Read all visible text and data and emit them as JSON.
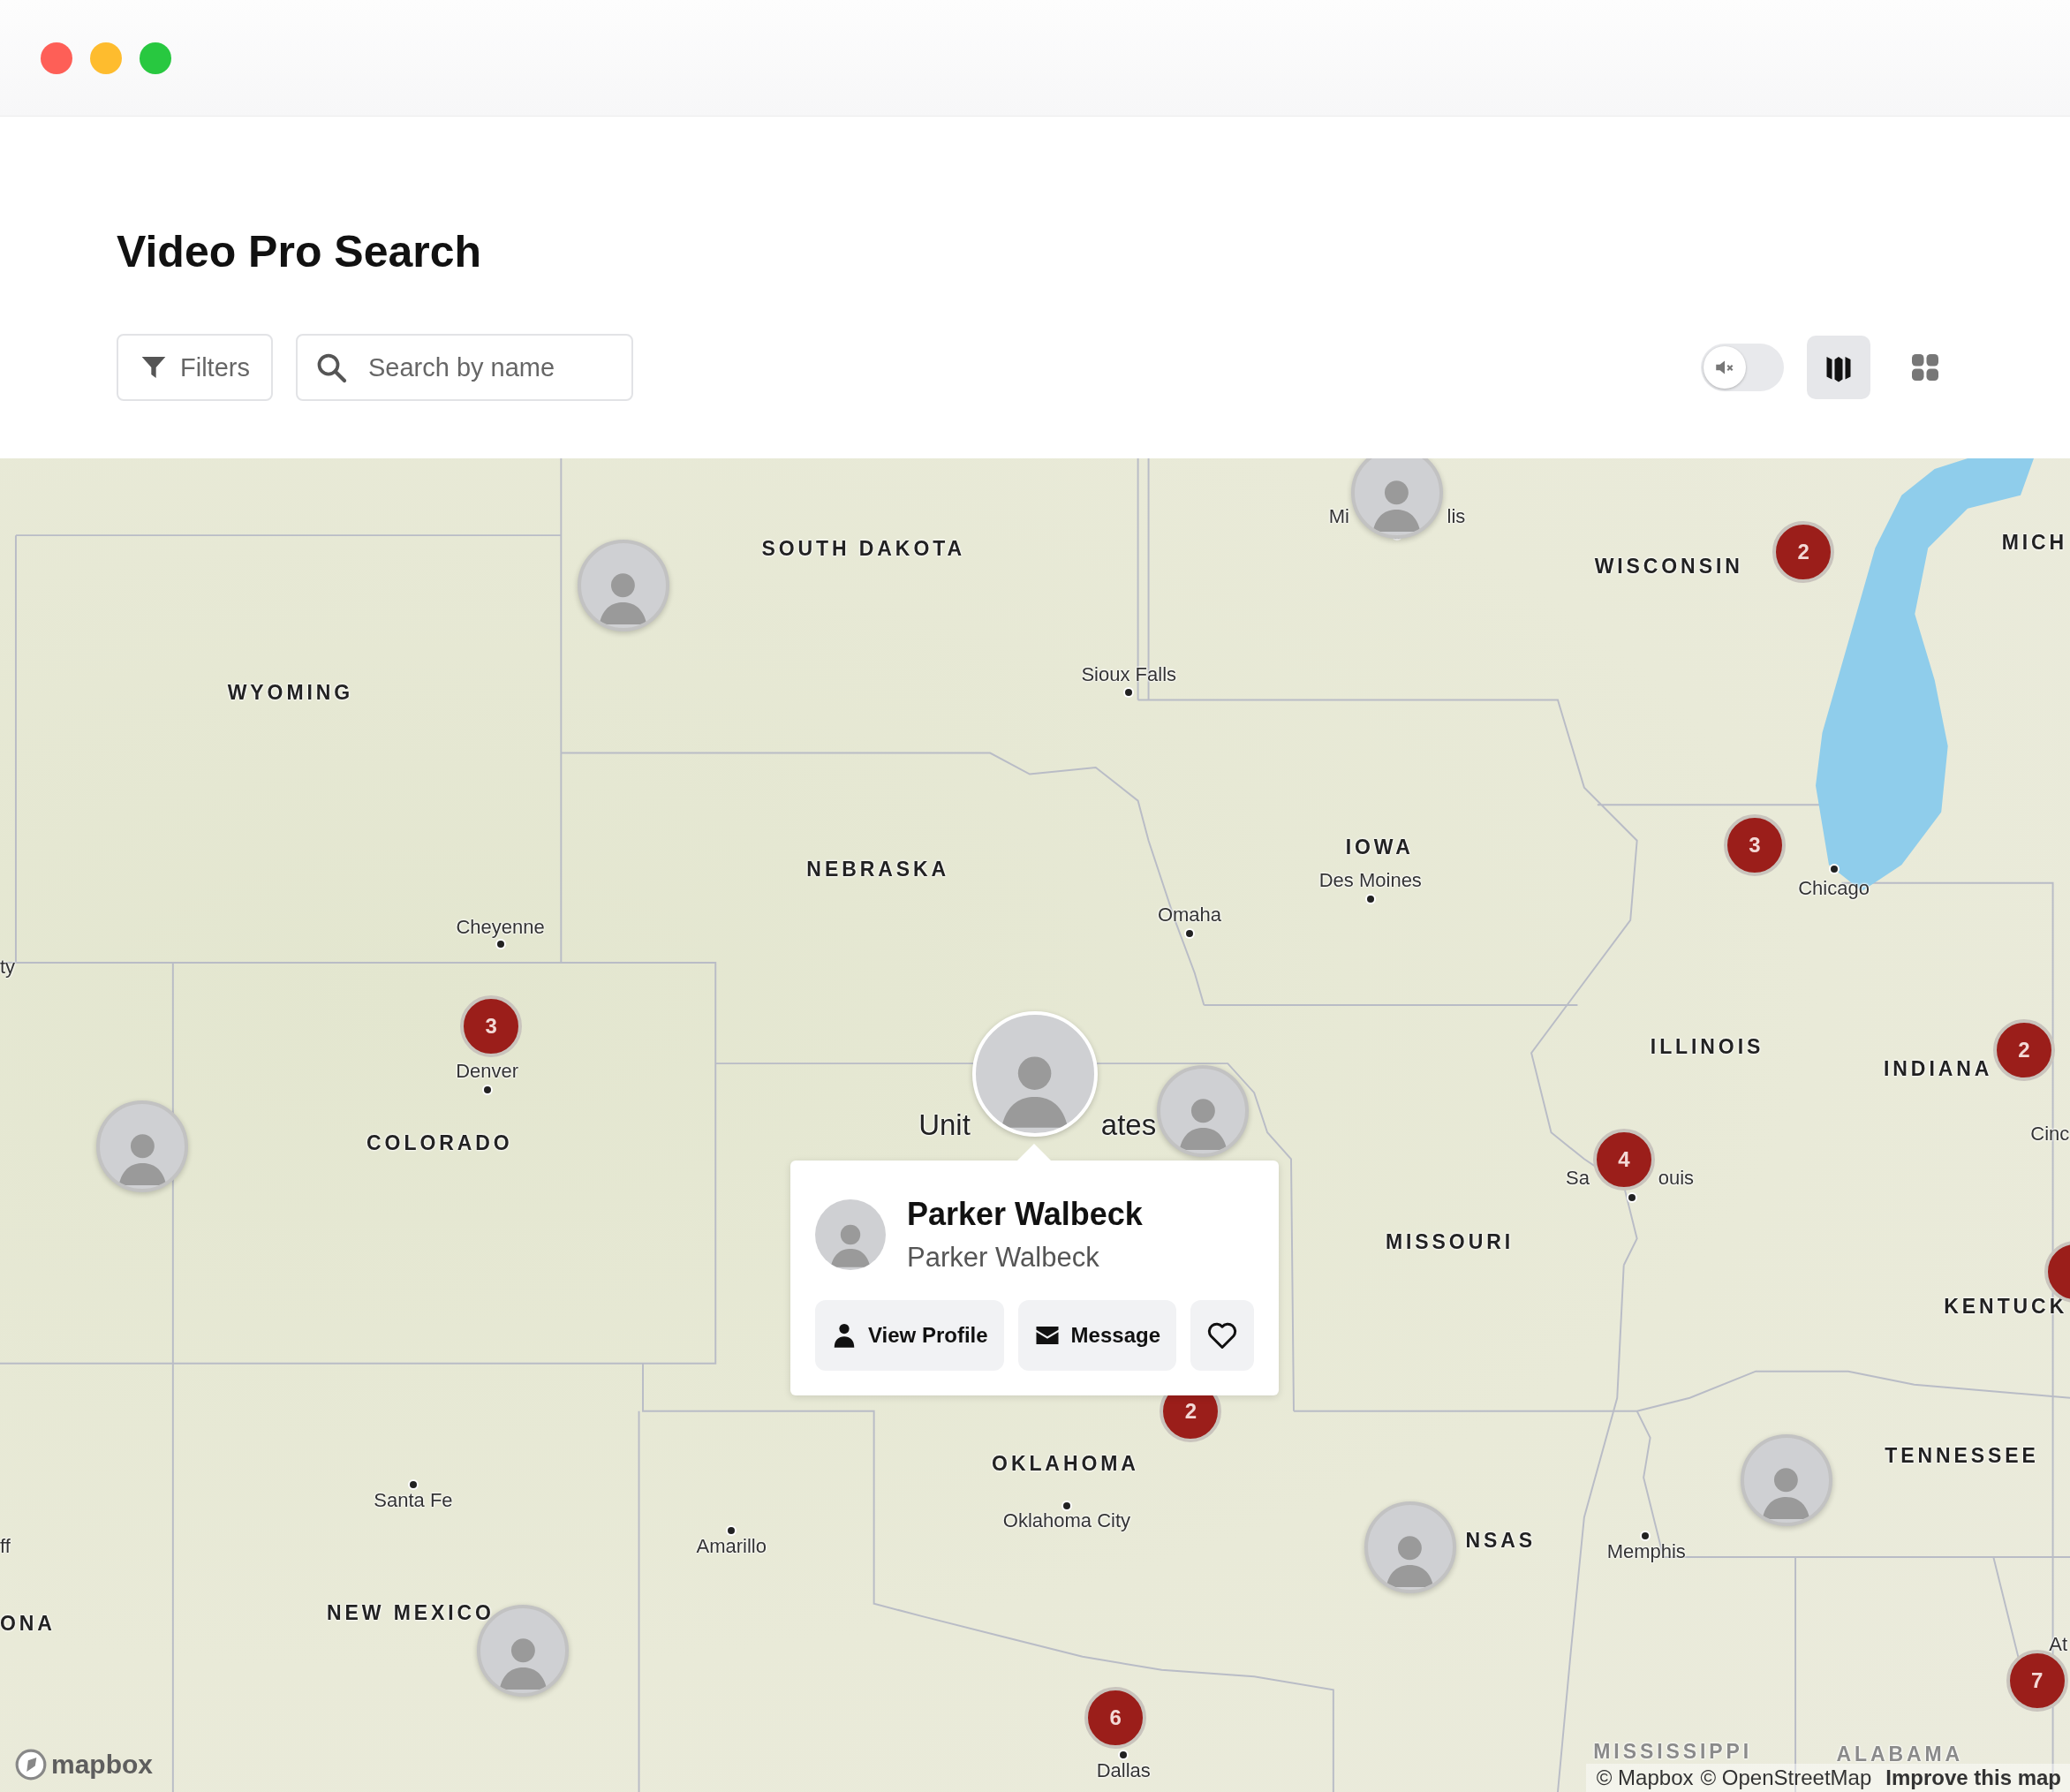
{
  "title": "Video Pro Search",
  "toolbar": {
    "filters_button": "Filters",
    "search": {
      "placeholder": "Search by name"
    },
    "sound_toggle": {
      "on": false
    },
    "view_buttons": [
      {
        "kind": "map",
        "selected": true
      },
      {
        "kind": "grid",
        "selected": false
      }
    ]
  },
  "map": {
    "labels": [
      {
        "kind": "state",
        "text": "SOUTH DAKOTA"
      },
      {
        "kind": "state",
        "text": "WISCONSIN"
      },
      {
        "kind": "state",
        "text": "MICH"
      },
      {
        "kind": "state",
        "text": "WYOMING"
      },
      {
        "kind": "state",
        "text": "NEBRASKA"
      },
      {
        "kind": "state",
        "text": "IOWA"
      },
      {
        "kind": "state",
        "text": "ILLINOIS"
      },
      {
        "kind": "state",
        "text": "INDIANA"
      },
      {
        "kind": "state",
        "text": "COLORADO"
      },
      {
        "kind": "state",
        "text": "MISSOURI"
      },
      {
        "kind": "state",
        "text": "KENTUCK"
      },
      {
        "kind": "state",
        "text": "OKLAHOMA"
      },
      {
        "kind": "state",
        "text": "TENNESSEE"
      },
      {
        "kind": "state",
        "text": "NSAS"
      },
      {
        "kind": "state",
        "text": "NEW MEXICO"
      },
      {
        "kind": "state",
        "text": "ONA"
      },
      {
        "kind": "faded",
        "text": "MISSISSIPPI"
      },
      {
        "kind": "faded",
        "text": "ALABAMA"
      },
      {
        "kind": "country",
        "text": "Unit"
      },
      {
        "kind": "country",
        "text": "ates"
      },
      {
        "kind": "city",
        "text": "Mi"
      },
      {
        "kind": "city",
        "text": "lis"
      },
      {
        "kind": "city",
        "text": "Sioux Falls"
      },
      {
        "kind": "city",
        "text": "Des Moines"
      },
      {
        "kind": "city",
        "text": "Omaha"
      },
      {
        "kind": "city",
        "text": "Cheyenne"
      },
      {
        "kind": "city",
        "text": "Chicago"
      },
      {
        "kind": "city",
        "text": "ty"
      },
      {
        "kind": "city",
        "text": "Denver"
      },
      {
        "kind": "city",
        "text": "Cinc"
      },
      {
        "kind": "city",
        "text": "Sa"
      },
      {
        "kind": "city",
        "text": "ouis"
      },
      {
        "kind": "city",
        "text": "ff"
      },
      {
        "kind": "city",
        "text": "Santa Fe"
      },
      {
        "kind": "city",
        "text": "Amarillo"
      },
      {
        "kind": "city",
        "text": "Oklahoma City"
      },
      {
        "kind": "city",
        "text": "Memphis"
      },
      {
        "kind": "city",
        "text": "At"
      },
      {
        "kind": "city",
        "text": "Dallas"
      }
    ],
    "clusters": [
      {
        "count": "2"
      },
      {
        "count": "3"
      },
      {
        "count": "2"
      },
      {
        "count": "3"
      },
      {
        "count": "4"
      },
      {
        "count": "2"
      },
      {
        "count": "6"
      },
      {
        "count": "7"
      }
    ],
    "avatars": [
      {
        "selected": false
      },
      {
        "selected": false
      },
      {
        "selected": false
      },
      {
        "selected": true
      },
      {
        "selected": false
      },
      {
        "selected": false
      },
      {
        "selected": false
      },
      {
        "selected": false
      }
    ],
    "popup": {
      "name": "Parker Walbeck",
      "subtitle": "Parker Walbeck",
      "buttons": [
        {
          "kind": "profile",
          "label": "View Profile"
        },
        {
          "kind": "message",
          "label": "Message"
        },
        {
          "kind": "favorite"
        }
      ],
      "favorited": false
    },
    "logo": "mapbox",
    "attribution": [
      "© Mapbox",
      "© OpenStreetMap"
    ],
    "improve_link": "Improve this map"
  }
}
